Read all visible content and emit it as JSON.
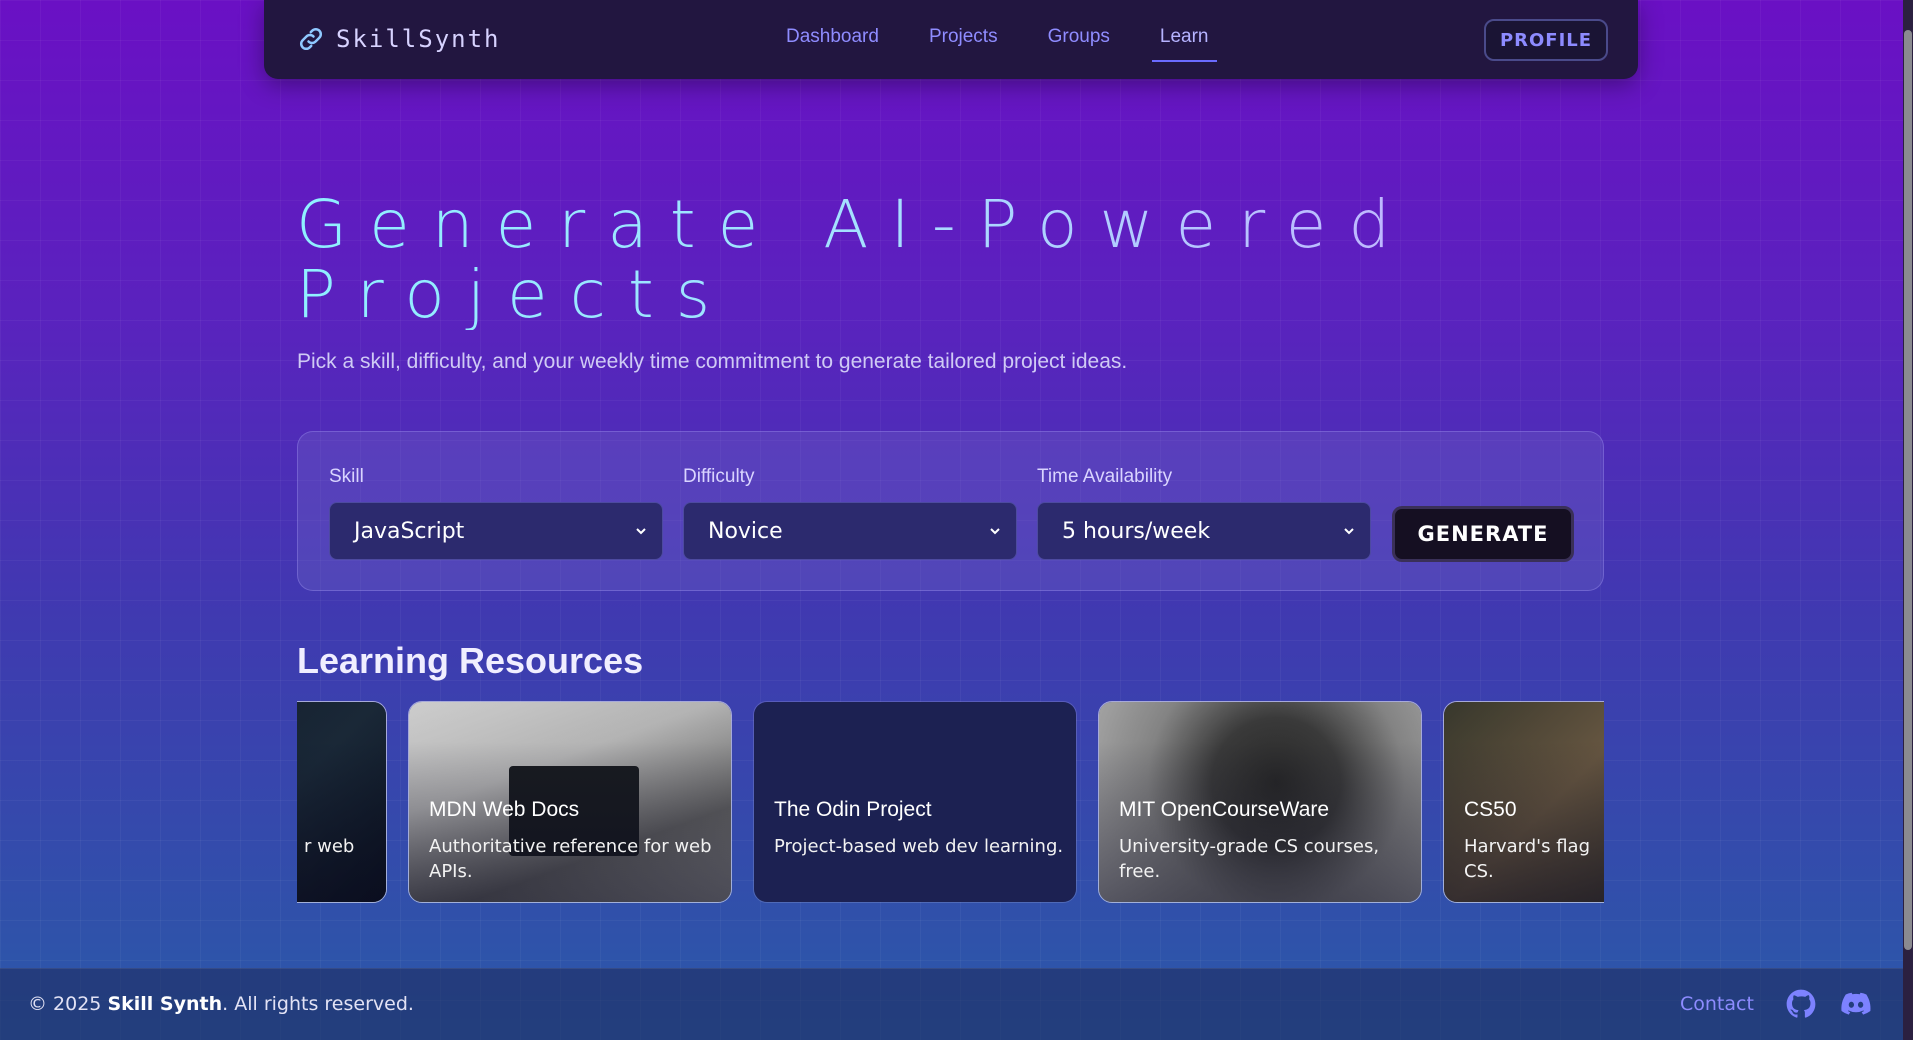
{
  "nav": {
    "brand": "SkillSynth",
    "links": [
      {
        "label": "Dashboard"
      },
      {
        "label": "Projects"
      },
      {
        "label": "Groups"
      },
      {
        "label": "Learn"
      }
    ],
    "active": "Learn",
    "profile_label": "PROFILE"
  },
  "hero": {
    "title_line1": "Generate AI-Powered",
    "title_line2": "Projects",
    "subtitle": "Pick a skill, difficulty, and your weekly time commitment to generate tailored project ideas."
  },
  "form": {
    "skill_label": "Skill",
    "skill_value": "JavaScript",
    "difficulty_label": "Difficulty",
    "difficulty_value": "Novice",
    "time_label": "Time Availability",
    "time_value": "5 hours/week",
    "generate_label": "GENERATE"
  },
  "resources": {
    "heading": "Learning Resources",
    "cards": [
      {
        "title": "",
        "desc": "r web"
      },
      {
        "title": "MDN Web Docs",
        "desc": "Authoritative reference for web APIs."
      },
      {
        "title": "The Odin Project",
        "desc": "Project-based web dev learning."
      },
      {
        "title": "MIT OpenCourseWare",
        "desc": "University-grade CS courses, free."
      },
      {
        "title": "CS50",
        "desc": "Harvard's flag CS."
      }
    ]
  },
  "footer": {
    "copyright_prefix": "© 2025",
    "copyright_brand": "Skill Synth",
    "copyright_suffix": ". All rights reserved.",
    "contact_label": "Contact"
  },
  "icons": {
    "brand": "link-icon",
    "github": "github-icon",
    "discord": "discord-icon",
    "select": "chevron-down-icon"
  },
  "colors": {
    "accent": "#8d8bff",
    "nav_bg": "#221640",
    "select_bg": "#2c2a6e"
  }
}
